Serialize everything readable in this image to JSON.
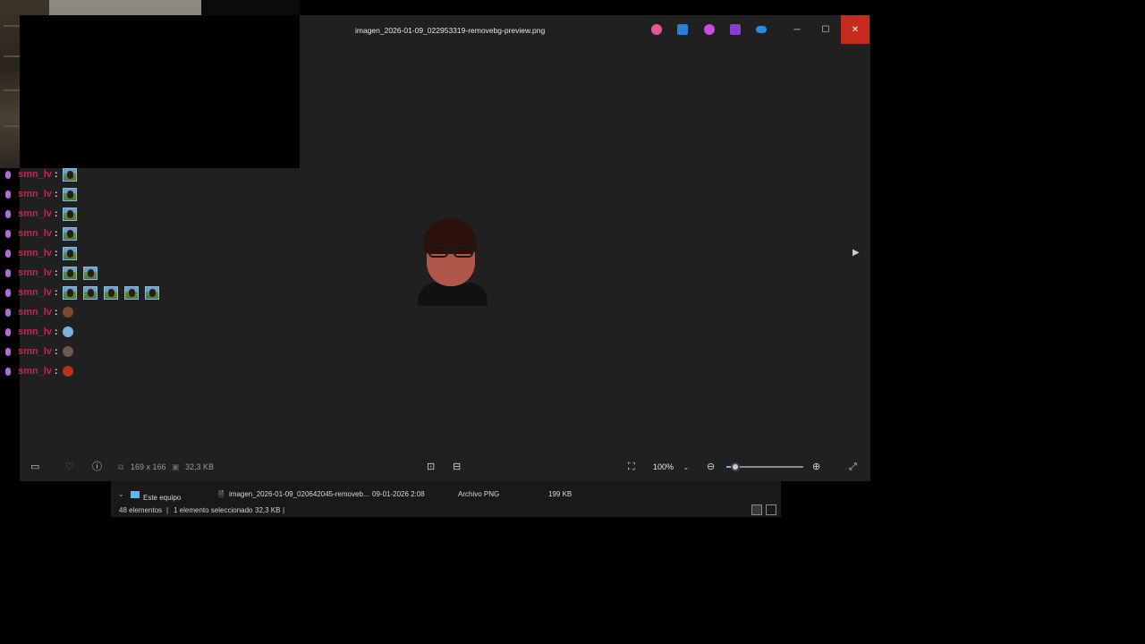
{
  "photos": {
    "file_title": "imagen_2026-01-09_022953319-removebg-preview.png",
    "title_icons": [
      "copilot-icon",
      "designer-icon",
      "clipchamp-icon",
      "clipchamp-purple-icon",
      "onedrive-icon"
    ],
    "window_buttons": {
      "minimize": "─",
      "maximize": "☐",
      "close": "✕"
    },
    "next_arrow": "▶",
    "bottom": {
      "dimensions": "169 x 166",
      "size": "32,3 KB",
      "zoom": "100%",
      "zoom_level_percent": 12
    }
  },
  "chat": {
    "username": "smn_lv",
    "colon": ":",
    "lines": [
      {
        "emotes": 1
      },
      {
        "emotes": 1
      },
      {
        "emotes": 1
      },
      {
        "emotes": 1
      },
      {
        "emotes": 1
      },
      {
        "emotes": 2
      },
      {
        "emotes": 5
      },
      {
        "emotes": 0,
        "small": "#7a4a2a"
      },
      {
        "emotes": 0,
        "small": "#7fb0d8"
      },
      {
        "emotes": 0,
        "small": "#6d5a4c"
      },
      {
        "emotes": 0,
        "small": "#b8321c"
      }
    ]
  },
  "explorer": {
    "tree_item": "Este equipo",
    "file_name": "imagen_2026-01-09_020642045-removeb...",
    "file_date": "09-01-2026 2:08",
    "file_type": "Archivo PNG",
    "file_size": "199 KB",
    "status_count": "48 elementos",
    "status_selected": "1 elemento seleccionado",
    "status_size": "32,3 KB",
    "separator": "|"
  }
}
